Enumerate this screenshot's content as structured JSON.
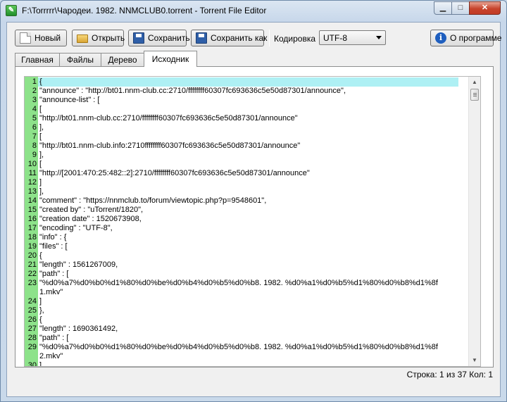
{
  "window": {
    "title": "F:\\Torrrrr\\Чародеи. 1982. NNMCLUB0.torrent - Torrent File Editor",
    "minimize": "▁",
    "maximize": "□",
    "close": "✕"
  },
  "toolbar": {
    "new_label": "Новый",
    "open_label": "Открыть",
    "save_label": "Сохранить",
    "save_as_label": "Сохранить как",
    "encoding_label": "Кодировка",
    "encoding_value": "UTF-8",
    "about_label": "О программе"
  },
  "tabs": [
    "Главная",
    "Файлы",
    "Дерево",
    "Исходник"
  ],
  "active_tab": "Исходник",
  "editor": {
    "current_line": 1,
    "lines": [
      {
        "n": "1",
        "t": "{"
      },
      {
        "n": "2",
        "t": " \"announce\" : \"http://bt01.nnm-club.cc:2710/ffffffff60307fc693636c5e50d87301/announce\","
      },
      {
        "n": "3",
        "t": " \"announce-list\" : ["
      },
      {
        "n": "4",
        "t": "  ["
      },
      {
        "n": "5",
        "t": "   \"http://bt01.nnm-club.cc:2710/ffffffff60307fc693636c5e50d87301/announce\""
      },
      {
        "n": "6",
        "t": "  ],"
      },
      {
        "n": "7",
        "t": "  ["
      },
      {
        "n": "8",
        "t": "   \"http://bt01.nnm-club.info:2710ffffffff60307fc693636c5e50d87301/announce\""
      },
      {
        "n": "9",
        "t": "  ],"
      },
      {
        "n": "10",
        "t": "  ["
      },
      {
        "n": "11",
        "t": "   \"http://[2001:470:25:482::2]:2710/ffffffff60307fc693636c5e50d87301/announce\""
      },
      {
        "n": "12",
        "t": "  ]"
      },
      {
        "n": "13",
        "t": " ],"
      },
      {
        "n": "14",
        "t": " \"comment\" : \"https://nnmclub.to/forum/viewtopic.php?p=9548601\","
      },
      {
        "n": "15",
        "t": " \"created by\" : \"uTorrent/1820\","
      },
      {
        "n": "16",
        "t": " \"creation date\" : 1520673908,"
      },
      {
        "n": "17",
        "t": " \"encoding\" : \"UTF-8\","
      },
      {
        "n": "18",
        "t": " \"info\" : {"
      },
      {
        "n": "19",
        "t": "  \"files\" : ["
      },
      {
        "n": "20",
        "t": "   {"
      },
      {
        "n": "21",
        "t": "    \"length\" : 1561267009,"
      },
      {
        "n": "22",
        "t": "    \"path\" : ["
      },
      {
        "n": "23",
        "t": "     \"%d0%a7%d0%b0%d1%80%d0%be%d0%b4%d0%b5%d0%b8. 1982. %d0%a1%d0%b5%d1%80%d0%b8%d1%8f"
      },
      {
        "n": "",
        "t": "1.mkv\""
      },
      {
        "n": "24",
        "t": "    ]"
      },
      {
        "n": "25",
        "t": "   },"
      },
      {
        "n": "26",
        "t": "   {"
      },
      {
        "n": "27",
        "t": "    \"length\" : 1690361492,"
      },
      {
        "n": "28",
        "t": "    \"path\" : ["
      },
      {
        "n": "29",
        "t": "     \"%d0%a7%d0%b0%d1%80%d0%be%d0%b4%d0%b5%d0%b8. 1982. %d0%a1%d0%b5%d1%80%d0%b8%d1%8f"
      },
      {
        "n": "",
        "t": "2.mkv\""
      },
      {
        "n": "30",
        "t": "    ]"
      }
    ]
  },
  "status": {
    "text": "Строка: 1 из 37 Кол: 1"
  }
}
